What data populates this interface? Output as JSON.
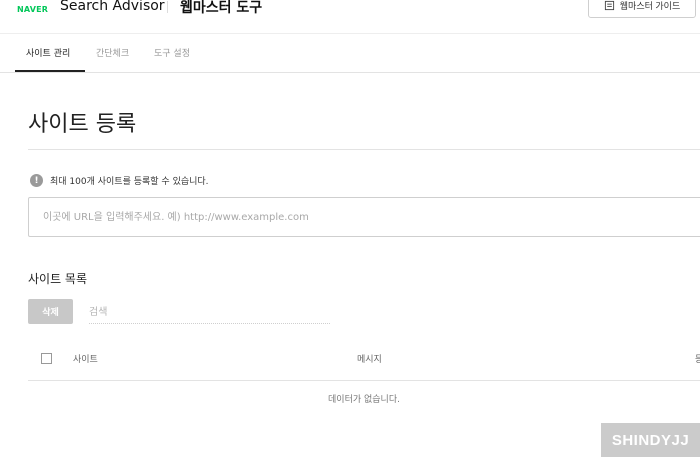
{
  "header": {
    "logo": "NAVER",
    "brand": "Search Advisor",
    "product": "웹마스터 도구",
    "guide_button": "웹마스터 가이드"
  },
  "tabs": [
    {
      "label": "사이트 관리",
      "active": true
    },
    {
      "label": "간단체크",
      "active": false
    },
    {
      "label": "도구 설정",
      "active": false
    }
  ],
  "page": {
    "title": "사이트 등록",
    "info_text": "최대 100개 사이트를 등록할 수 있습니다.",
    "url_placeholder": "이곳에 URL을 입력해주세요. 예) http://www.example.com"
  },
  "site_list": {
    "title": "사이트 목록",
    "delete_button": "삭제",
    "search_placeholder": "검색",
    "columns": [
      "사이트",
      "메시지",
      "등"
    ],
    "empty_text": "데이터가 없습니다."
  },
  "watermark": "SHINDYJJ",
  "colors": {
    "naver_green": "#03c75a",
    "disabled_button": "#c8c8c8"
  }
}
